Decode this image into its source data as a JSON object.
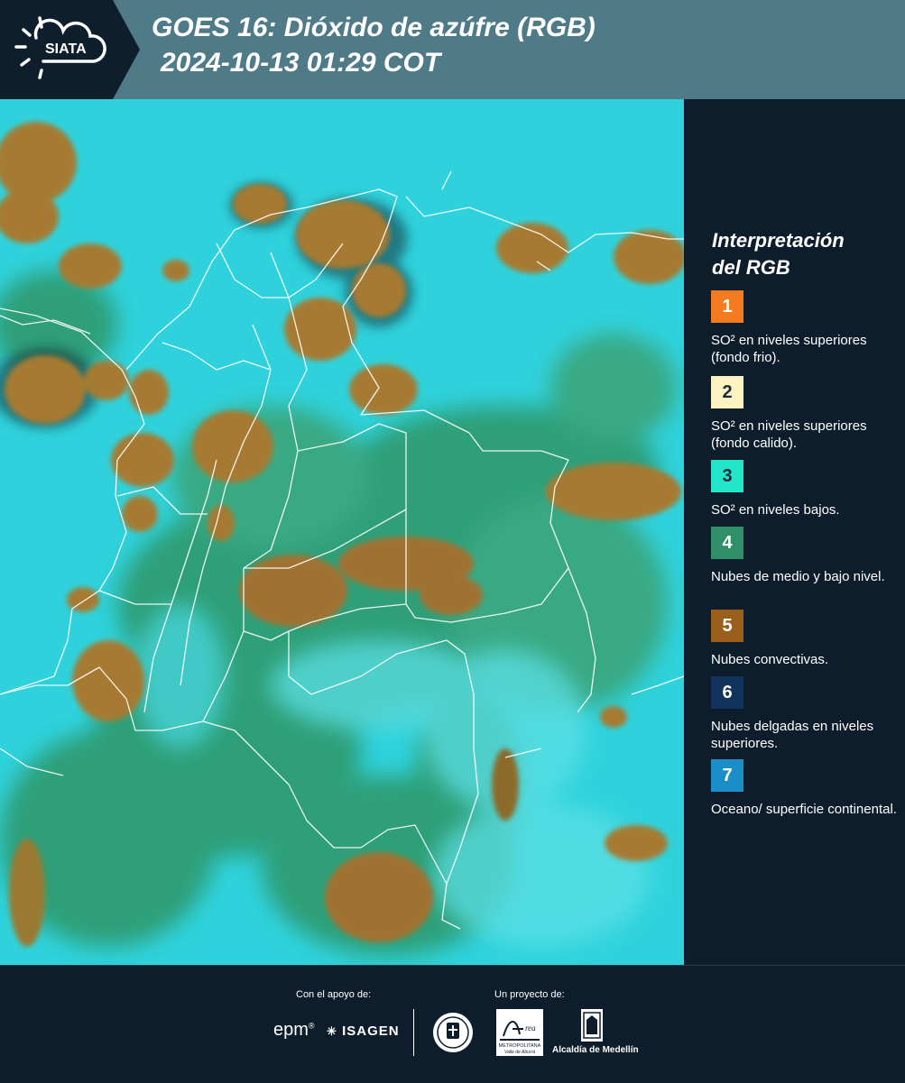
{
  "header": {
    "logo_text": "SIATA",
    "title_line1": "GOES 16: Dióxido de azúfre (RGB)",
    "title_line2": "2024-10-13 01:29 COT"
  },
  "legend": {
    "title_line1": "Interpretación",
    "title_line2": "del RGB",
    "items": [
      {
        "number": "1",
        "color": "#f47b20",
        "number_color": "#ffffff",
        "text": "SO² en niveles superiores (fondo frio)."
      },
      {
        "number": "2",
        "color": "#fdf3c0",
        "number_color": "#1a2a3a",
        "text": "SO² en niveles superiores (fondo calido)."
      },
      {
        "number": "3",
        "color": "#23e6c9",
        "number_color": "#1a2a3a",
        "text": "SO² en niveles bajos."
      },
      {
        "number": "4",
        "color": "#2f8f66",
        "number_color": "#ffffff",
        "text": "Nubes de medio y bajo nivel."
      },
      {
        "number": "5",
        "color": "#9a5f1d",
        "number_color": "#ffffff",
        "text": "Nubes convectivas."
      },
      {
        "number": "6",
        "color": "#13335f",
        "number_color": "#ffffff",
        "text": "Nubes delgadas en niveles superiores."
      },
      {
        "number": "7",
        "color": "#1a8fc7",
        "number_color": "#ffffff",
        "text": "Oceano/ superficie continental."
      }
    ]
  },
  "footer": {
    "support_label": "Con el apoyo de:",
    "project_label": "Un proyecto de:",
    "sponsor1": "epm",
    "sponsor2": "ISAGEN",
    "partner1": "METROPOLITANA",
    "partner1_sub": "Valle de Aburrá",
    "partner2": "Alcaldía de Medellín"
  },
  "colors": {
    "header_bg": "#4f7b88",
    "dark_bg": "#0e1d2b",
    "map_background": "#2fd2dc",
    "cloud_brown": "#a67a32",
    "cloud_green": "#2e9a6e"
  }
}
